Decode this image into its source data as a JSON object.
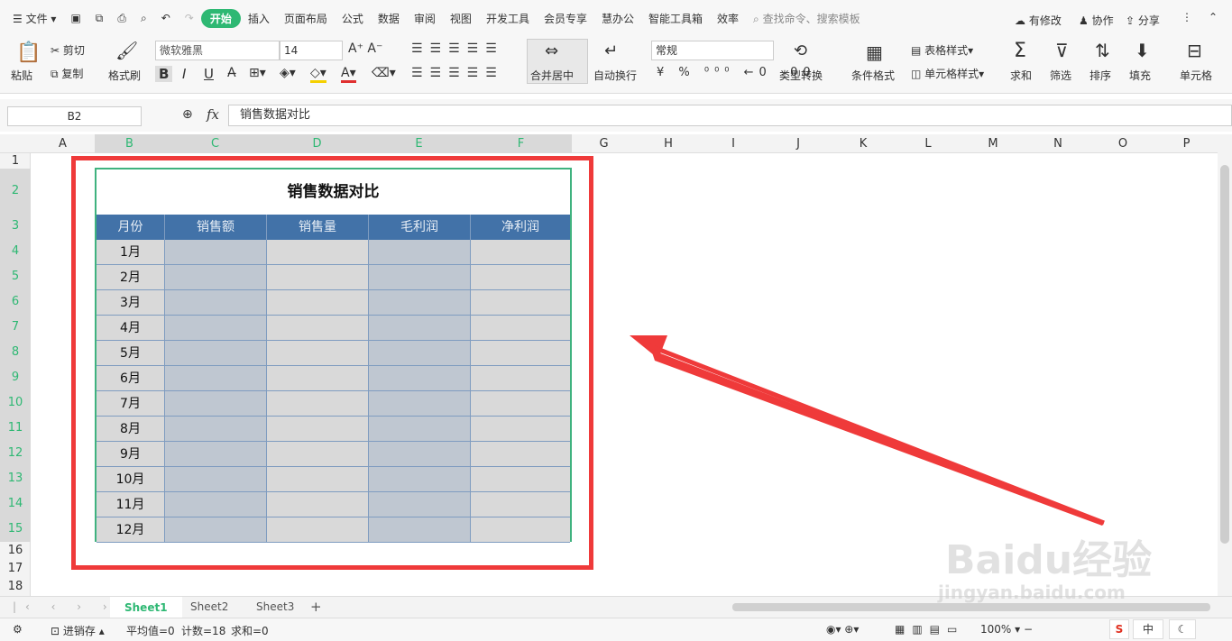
{
  "menu": {
    "file": "文件",
    "tabs": [
      "开始",
      "插入",
      "页面布局",
      "公式",
      "数据",
      "审阅",
      "视图",
      "开发工具",
      "会员专享",
      "慧办公",
      "智能工具箱",
      "效率"
    ],
    "search": "查找命令、搜索模板",
    "modify": "有修改",
    "collab": "协作",
    "share": "分享"
  },
  "ribbon": {
    "paste": "粘贴",
    "cut": "剪切",
    "copy": "复制",
    "format_painter": "格式刷",
    "font_name": "微软雅黑",
    "font_size": "14",
    "merge": "合并居中",
    "wrap": "自动换行",
    "number_format": "常规",
    "type_convert": "类型转换",
    "cond_format": "条件格式",
    "table_style": "表格样式",
    "cell_style": "单元格样式",
    "sum": "求和",
    "filter": "筛选",
    "sort": "排序",
    "fill": "填充",
    "cell": "单元格"
  },
  "formula": {
    "cell_ref": "B2",
    "fx": "fx",
    "content": "销售数据对比"
  },
  "columns": [
    "A",
    "B",
    "C",
    "D",
    "E",
    "F",
    "G",
    "H",
    "I",
    "J",
    "K",
    "L",
    "M",
    "N",
    "O",
    "P"
  ],
  "rows": [
    "1",
    "2",
    "3",
    "4",
    "5",
    "6",
    "7",
    "8",
    "9",
    "10",
    "11",
    "12",
    "13",
    "14",
    "15",
    "16",
    "17",
    "18"
  ],
  "table": {
    "title": "销售数据对比",
    "headers": [
      "月份",
      "销售额",
      "销售量",
      "毛利润",
      "净利润"
    ],
    "months": [
      "1月",
      "2月",
      "3月",
      "4月",
      "5月",
      "6月",
      "7月",
      "8月",
      "9月",
      "10月",
      "11月",
      "12月"
    ]
  },
  "sheets": [
    "Sheet1",
    "Sheet2",
    "Sheet3"
  ],
  "status": {
    "save": "进销存",
    "avg": "平均值=0",
    "count": "计数=18",
    "sum": "求和=0",
    "zoom": "100%",
    "ime": "中"
  },
  "watermark": {
    "brand": "Baidu经验",
    "url": "jingyan.baidu.com"
  },
  "colors": {
    "accent": "#2eb873",
    "header_blue": "#4272a8",
    "annotation_red": "#ef3a3a"
  }
}
